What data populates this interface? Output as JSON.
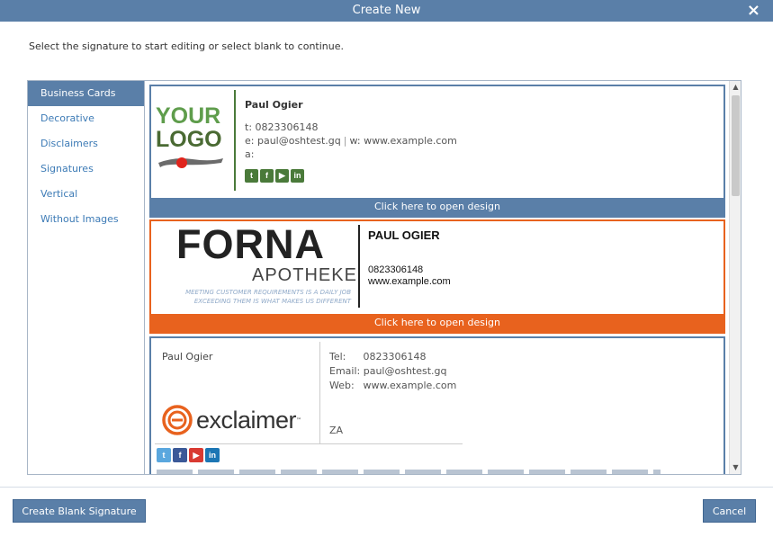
{
  "window": {
    "title": "Create New",
    "close_icon": "×"
  },
  "instruction": "Select the signature to start editing or select blank to continue.",
  "sidebar": {
    "items": [
      {
        "label": "Business Cards",
        "active": true
      },
      {
        "label": "Decorative"
      },
      {
        "label": "Disclaimers"
      },
      {
        "label": "Signatures"
      },
      {
        "label": "Vertical"
      },
      {
        "label": "Without Images"
      }
    ]
  },
  "templates": [
    {
      "logo_line1": "YOUR",
      "logo_line2": "LOGO",
      "name": "Paul Ogier",
      "phone_line": "t: 0823306148",
      "email_part": "e: paul@oshtest.gq",
      "separator": "|",
      "web_part": "w: www.example.com",
      "address_line": "a:",
      "social_icons": [
        "twitter-icon",
        "facebook-icon",
        "youtube-icon",
        "linkedin-icon"
      ],
      "open_label": "Click here to open design",
      "accent": "#4a7a3a"
    },
    {
      "logo_main": "FORNA",
      "logo_sub": "APOTHEKE",
      "tagline_1": "MEETING CUSTOMER REQUIREMENTS IS A DAILY JOB",
      "tagline_2": "EXCEEDING THEM IS WHAT MAKES US DIFFERENT",
      "name": "PAUL OGIER",
      "phone": "0823306148",
      "web": "www.example.com",
      "open_label": "Click here to open design",
      "accent": "#e8621e"
    },
    {
      "name": "Paul Ogier",
      "tel_label": "Tel:",
      "tel_value": "0823306148",
      "email_label": "Email:",
      "email_value": "paul@oshtest.gq",
      "web_label": "Web:",
      "web_value": "www.example.com",
      "country": "ZA",
      "logo_text": "exclaimer",
      "logo_tm": "™",
      "social_icons": [
        "twitter-icon",
        "facebook-icon",
        "youtube-icon",
        "linkedin-icon"
      ]
    }
  ],
  "footer": {
    "blank_button": "Create Blank Signature",
    "cancel_button": "Cancel"
  },
  "colors": {
    "primary": "#5a7fa8",
    "orange": "#e8621e",
    "link": "#3d7bb6"
  }
}
